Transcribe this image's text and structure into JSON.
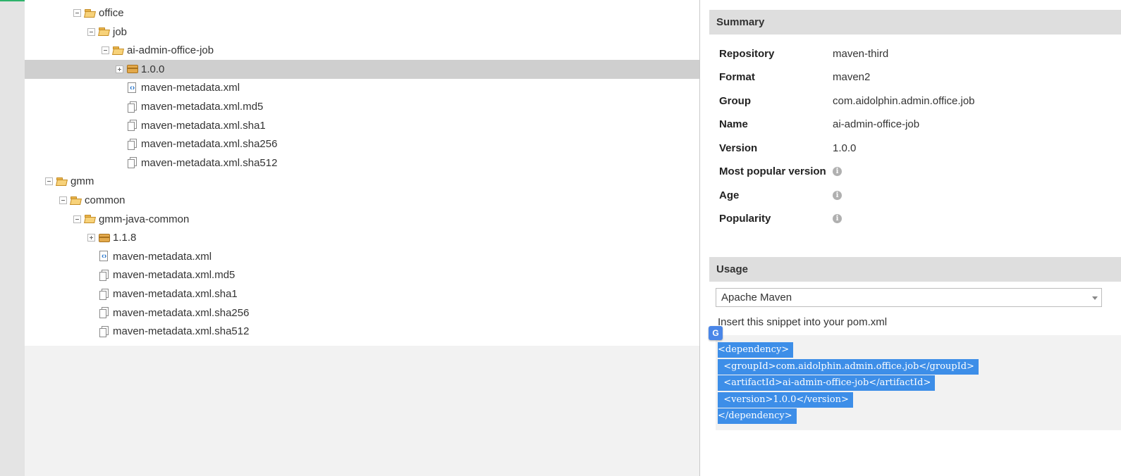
{
  "tree": {
    "rows": [
      {
        "label": "office",
        "icon": "folder-icon",
        "expander": "minus",
        "depth": 3
      },
      {
        "label": "job",
        "icon": "folder-icon",
        "expander": "minus",
        "depth": 4
      },
      {
        "label": "ai-admin-office-job",
        "icon": "folder-icon",
        "expander": "minus",
        "depth": 5
      },
      {
        "label": "1.0.0",
        "icon": "package-icon",
        "expander": "plus",
        "depth": 6,
        "selected": true
      },
      {
        "label": "maven-metadata.xml",
        "icon": "xml-icon",
        "expander": "none",
        "depth": 6
      },
      {
        "label": "maven-metadata.xml.md5",
        "icon": "file-icon",
        "expander": "none",
        "depth": 6
      },
      {
        "label": "maven-metadata.xml.sha1",
        "icon": "file-icon",
        "expander": "none",
        "depth": 6
      },
      {
        "label": "maven-metadata.xml.sha256",
        "icon": "file-icon",
        "expander": "none",
        "depth": 6
      },
      {
        "label": "maven-metadata.xml.sha512",
        "icon": "file-icon",
        "expander": "none",
        "depth": 6
      },
      {
        "label": "gmm",
        "icon": "folder-icon",
        "expander": "minus",
        "depth": 1
      },
      {
        "label": "common",
        "icon": "folder-icon",
        "expander": "minus",
        "depth": 2
      },
      {
        "label": "gmm-java-common",
        "icon": "folder-icon",
        "expander": "minus",
        "depth": 3
      },
      {
        "label": "1.1.8",
        "icon": "package-icon",
        "expander": "plus",
        "depth": 4
      },
      {
        "label": "maven-metadata.xml",
        "icon": "xml-icon",
        "expander": "none",
        "depth": 4
      },
      {
        "label": "maven-metadata.xml.md5",
        "icon": "file-icon",
        "expander": "none",
        "depth": 4
      },
      {
        "label": "maven-metadata.xml.sha1",
        "icon": "file-icon",
        "expander": "none",
        "depth": 4
      },
      {
        "label": "maven-metadata.xml.sha256",
        "icon": "file-icon",
        "expander": "none",
        "depth": 4
      },
      {
        "label": "maven-metadata.xml.sha512",
        "icon": "file-icon",
        "expander": "none",
        "depth": 4
      }
    ]
  },
  "summary": {
    "title": "Summary",
    "fields": [
      {
        "key": "Repository",
        "value": "maven-third"
      },
      {
        "key": "Format",
        "value": "maven2"
      },
      {
        "key": "Group",
        "value": "com.aidolphin.admin.office.job"
      },
      {
        "key": "Name",
        "value": "ai-admin-office-job"
      },
      {
        "key": "Version",
        "value": "1.0.0"
      },
      {
        "key": "Most popular version",
        "value": "",
        "info": true
      },
      {
        "key": "Age",
        "value": "",
        "info": true
      },
      {
        "key": "Popularity",
        "value": "",
        "info": true
      }
    ]
  },
  "usage": {
    "title": "Usage",
    "selected_tool": "Apache Maven",
    "hint": "Insert this snippet into your pom.xml",
    "snippet": [
      "<dependency>",
      "  <groupId>com.aidolphin.admin.office.job</groupId>",
      "  <artifactId>ai-admin-office-job</artifactId>",
      "  <version>1.0.0</version>",
      "</dependency>"
    ]
  },
  "colors": {
    "selection": "#3d8ee8",
    "accent": "#2fb36b",
    "header_bg": "#dedede"
  }
}
